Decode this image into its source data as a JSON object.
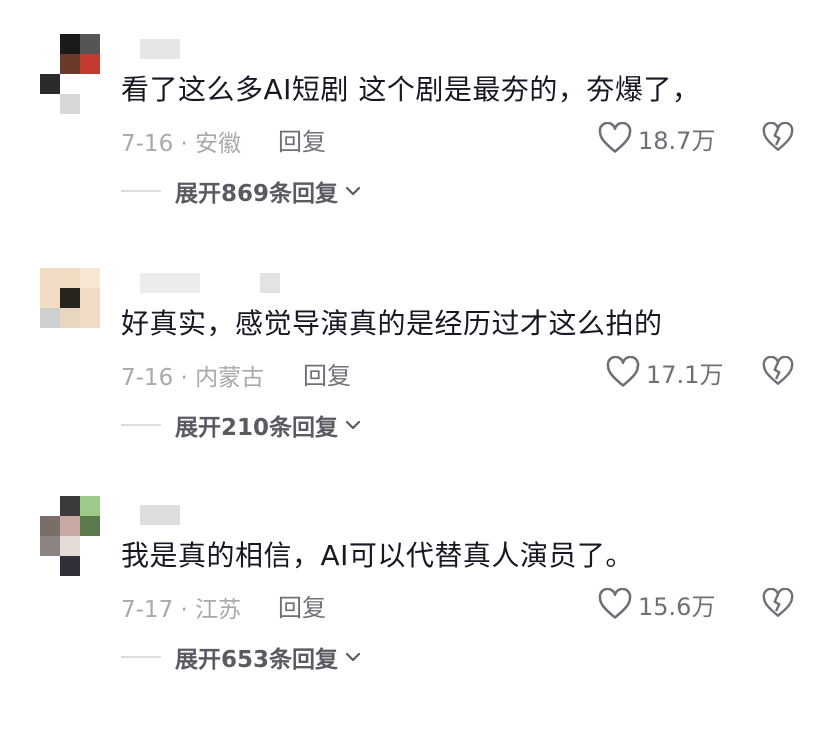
{
  "comments": [
    {
      "text": "看了这么多AI短剧 这个剧是最夯的，夯爆了，",
      "meta": "7-16 · 安徽",
      "reply_label": "回复",
      "likes": "18.7万",
      "expand_label": "展开869条回复"
    },
    {
      "text": "好真实，感觉导演真的是经历过才这么拍的",
      "meta": "7-16 · 内蒙古",
      "reply_label": "回复",
      "likes": "17.1万",
      "expand_label": "展开210条回复"
    },
    {
      "text": "我是真的相信，AI可以代替真人演员了。",
      "meta": "7-17 · 江苏",
      "reply_label": "回复",
      "likes": "15.6万",
      "expand_label": "展开653条回复"
    }
  ],
  "icons": {
    "like": "heart-outline-icon",
    "dislike": "broken-heart-icon",
    "expand": "chevron-down-icon"
  },
  "colors": {
    "text": "#161823",
    "meta": "#a8a8ad",
    "action": "#6f6f78",
    "expand": "#5a5a63"
  }
}
